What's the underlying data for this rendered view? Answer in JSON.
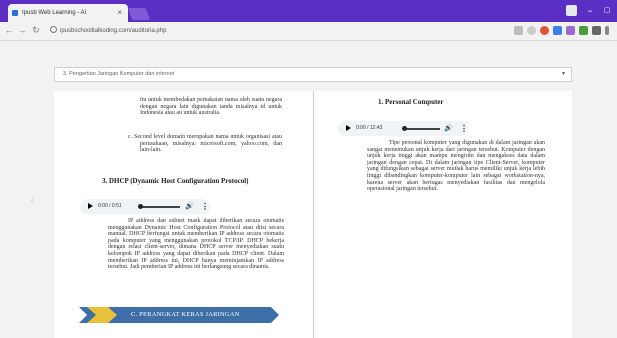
{
  "browser": {
    "tab_title": "Ipusb Web Learning - Al",
    "tab_close": "×",
    "url": "ipusbschoolitalkoding.com/auditoria.php",
    "minimize": "−",
    "maximize": "▢",
    "close": "✕"
  },
  "page": {
    "chapter_select": "3. Pengertian Jaringan Komputer dan internet",
    "left_page": {
      "paragraph_top": "itu untuk membedakan pemakaian nama oleh suatu negara dengan negara lain digunakan tanda misalnya id untuk Indonesia atau au untuk australia.",
      "item_c": "c.   Second level domain merupakan nama untuk organisasi atau perusahaan, misalnya: microsoft.com, yahoo.com, dan lain-lain.",
      "heading_dhcp": "3.    DHCP (Dynamic Host Configuration Protocol)",
      "audio_time": "0:00 / 0:51",
      "paragraph_dhcp": "IP address dan subnet mask dapat diberikan secara otomatis menggunakan Dynamic Host Configuration Protocol atau diisi secara manual. DHCP berfungsi untuk memberikan IP address secara otomatis pada komputer yang menggunakan protokol TCP/IP. DHCP bekerja dengan relasi client-server, dimana DHCP server menyediakan suatu kelompok IP address yang dapat diberikan pada DHCP client. Dalam memberikan IP address ini, DHCP hanya meminjamkan IP address tersebut. Jadi pemberian IP address ini berlangsung secara dinamis.",
      "banner": "C. PERANGKAT KERAS JARINGAN"
    },
    "right_page": {
      "heading": "1.  Personal Computer",
      "audio_time": "0:00 / 12:43",
      "paragraph": "Tipe personal komputer yang digunakan di dalam jaringan akan sangat menentukan unjuk kerja dari jaringan tersebut. Komputer dengan unjuk kerja tinggi akan mampu mengirim dan mengakses data dalam jaringan dengan cepat. Di dalam jaringan tipe Client-Server, komputer yang difungsikan sebagai server mutlak harus memiliki unjuk kerja lebih tinggi dibandingkan komputer-komputer lain sebagai workstation-nya, karena server akan bertugas menyediakan fasilitas dan mengelola operasional jaringan tersebut."
    }
  },
  "colors": {
    "titlebar": "#5b2ec4",
    "banner_blue": "#3e6ea7",
    "banner_yellow": "#e8c23a"
  }
}
